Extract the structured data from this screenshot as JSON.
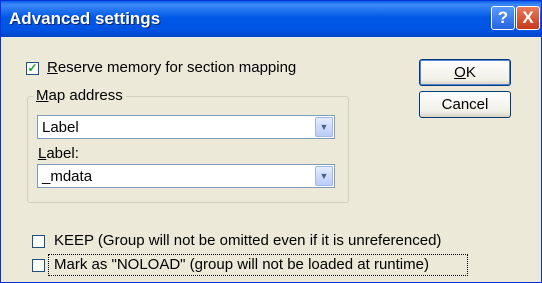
{
  "window": {
    "title": "Advanced settings"
  },
  "title_buttons": {
    "help": "?",
    "close": "X"
  },
  "reserve_memory": {
    "checked_mark": "✓",
    "label_first": "R",
    "label_rest": "eserve memory for section mapping"
  },
  "buttons": {
    "ok_first": "O",
    "ok_rest": "K",
    "cancel": "Cancel"
  },
  "map_address": {
    "group_label_first": "M",
    "group_label_rest": "ap address",
    "select_value": "Label",
    "field_label_first": "L",
    "field_label_rest": "abel:",
    "label_value": "_mdata"
  },
  "keep": {
    "label": "KEEP (Group will not be omitted even if it is unreferenced)"
  },
  "noload": {
    "label": "Mark as \"NOLOAD\" (group will not be loaded at runtime)"
  },
  "icons": {
    "dropdown": "▼"
  }
}
